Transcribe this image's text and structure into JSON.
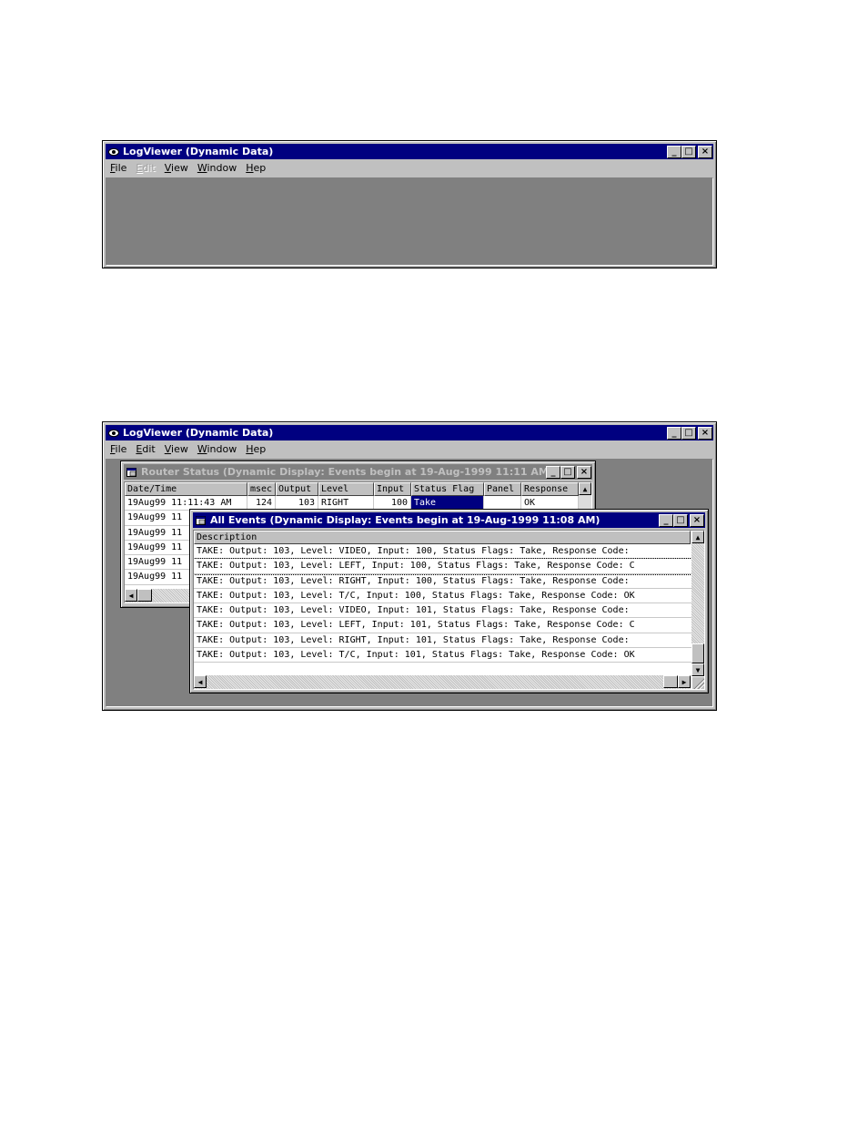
{
  "window_top": {
    "title": "LogViewer (Dynamic Data)",
    "menu": [
      {
        "label": "File",
        "key": "F",
        "rest": "ile",
        "enabled": true
      },
      {
        "label": "Edit",
        "key": "E",
        "rest": "dit",
        "enabled": false
      },
      {
        "label": "View",
        "key": "V",
        "rest": "iew",
        "enabled": true
      },
      {
        "label": "Window",
        "key": "W",
        "rest": "indow",
        "enabled": true
      },
      {
        "label": "Hep",
        "key": "H",
        "rest": "ep",
        "enabled": true
      }
    ]
  },
  "window_bottom": {
    "title": "LogViewer (Dynamic Data)",
    "menu": [
      {
        "label": "File",
        "key": "F",
        "rest": "ile",
        "enabled": true
      },
      {
        "label": "Edit",
        "key": "E",
        "rest": "dit",
        "enabled": true
      },
      {
        "label": "View",
        "key": "V",
        "rest": "iew",
        "enabled": true
      },
      {
        "label": "Window",
        "key": "W",
        "rest": "indow",
        "enabled": true
      },
      {
        "label": "Hep",
        "key": "H",
        "rest": "ep",
        "enabled": true
      }
    ],
    "router_status": {
      "title": "Router Status (Dynamic Display: Events begin at 19-Aug-1999 11:11 AM)",
      "columns": [
        "Date/Time",
        "msec",
        "Output",
        "Level",
        "Input",
        "Status Flag",
        "Panel",
        "Response"
      ],
      "first_row": [
        "19Aug99 11:11:43 AM",
        "124",
        "103",
        "RIGHT",
        "100",
        "Take",
        "",
        "OK"
      ],
      "other_rows": [
        "19Aug99 11",
        "19Aug99 11",
        "19Aug99 11",
        "19Aug99 11",
        "19Aug99 11"
      ]
    },
    "all_events": {
      "title": "All Events (Dynamic Display: Events begin at 19-Aug-1999 11:08 AM)",
      "column": "Description",
      "rows": [
        "TAKE: Output: 103, Level: VIDEO, Input: 100, Status Flags:  Take, Response Code:",
        "TAKE: Output: 103, Level: LEFT, Input: 100, Status Flags:  Take, Response Code: C",
        "TAKE: Output: 103, Level: RIGHT, Input: 100, Status Flags:  Take, Response Code:",
        "TAKE: Output: 103, Level: T/C, Input: 100, Status Flags:  Take, Response Code: OK",
        "TAKE: Output: 103, Level: VIDEO, Input: 101, Status Flags:  Take, Response Code:",
        "TAKE: Output: 103, Level: LEFT, Input: 101, Status Flags:  Take, Response Code: C",
        "TAKE: Output: 103, Level: RIGHT, Input: 101, Status Flags:  Take, Response Code:",
        "TAKE: Output: 103, Level: T/C, Input: 101, Status Flags:  Take, Response Code: OK"
      ]
    }
  },
  "icons": {
    "app": "eye-icon",
    "child": "document-window-icon",
    "minimize": "_",
    "maximize": "□",
    "close": "×",
    "arrow_up": "▲",
    "arrow_down": "▼",
    "arrow_left": "◀",
    "arrow_right": "▶"
  },
  "colors": {
    "active_title": "#000080",
    "inactive_title": "#808080",
    "mdi_background": "#808080",
    "selection": "#000080"
  }
}
